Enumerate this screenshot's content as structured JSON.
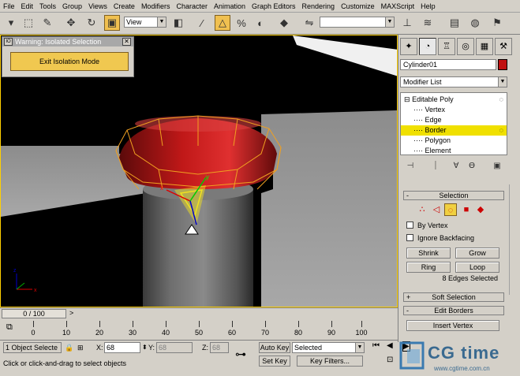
{
  "menu": [
    "File",
    "Edit",
    "Tools",
    "Group",
    "Views",
    "Create",
    "Modifiers",
    "Character",
    "Animation",
    "Graph Editors",
    "Rendering",
    "Customize",
    "MAXScript",
    "Help"
  ],
  "toolbar": {
    "view_select": "View",
    "icons": [
      "undo-icon",
      "select-object-icon",
      "select-by-name-icon",
      "move-icon",
      "rotate-icon",
      "scale-icon",
      "snap-icon",
      "angle-snap-icon",
      "percent-snap-icon",
      "spinner-snap-icon",
      "mirror-icon",
      "align-icon"
    ]
  },
  "isolation": {
    "title": "Warning: Isolated Selection",
    "button": "Exit Isolation Mode"
  },
  "command_panel": {
    "object_name": "Cylinder01",
    "object_color": "#c01010",
    "modifier_list": "Modifier List",
    "stack": [
      {
        "label": "Editable Poly",
        "level": 0,
        "selected": false
      },
      {
        "label": "Vertex",
        "level": 1,
        "selected": false
      },
      {
        "label": "Edge",
        "level": 1,
        "selected": false
      },
      {
        "label": "Border",
        "level": 1,
        "selected": true
      },
      {
        "label": "Polygon",
        "level": 1,
        "selected": false
      },
      {
        "label": "Element",
        "level": 1,
        "selected": false
      }
    ],
    "selection_rollout": "Selection",
    "by_vertex": "By Vertex",
    "ignore_backfacing": "Ignore Backfacing",
    "shrink": "Shrink",
    "grow": "Grow",
    "ring": "Ring",
    "loop": "Loop",
    "edges_selected": "8 Edges Selected",
    "soft_selection": "Soft Selection",
    "edit_borders": "Edit Borders",
    "insert_vertex": "Insert Vertex"
  },
  "timeline": {
    "slider": "0 / 100",
    "ticks": [
      "0",
      "10",
      "20",
      "30",
      "40",
      "50",
      "60",
      "70",
      "80",
      "90",
      "100"
    ]
  },
  "status": {
    "selection_count": "1 Object Selecte",
    "x_label": "X:",
    "x_value": "68",
    "y_label": "Y:",
    "y_value": "68",
    "z_label": "Z:",
    "z_value": "68",
    "auto_key": "Auto Key",
    "set_key": "Set Key",
    "selected": "Selected",
    "key_filters": "Key Filters...",
    "prompt": "Click or click-and-drag to select objects"
  },
  "watermark": {
    "brand": "CG time",
    "url": "www.cgtime.com.cn"
  }
}
